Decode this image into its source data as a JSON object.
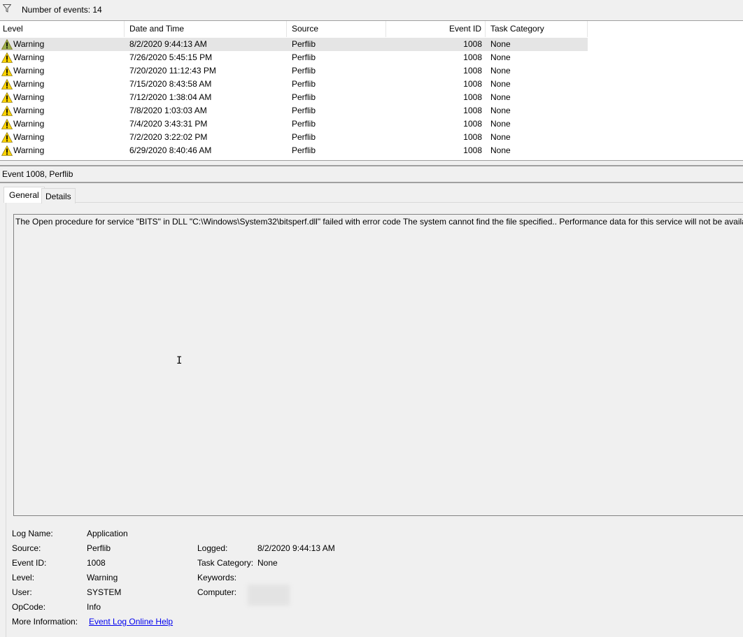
{
  "toolbar": {
    "event_count": "Number of events: 14"
  },
  "columns": [
    "Level",
    "Date and Time",
    "Source",
    "Event ID",
    "Task Category"
  ],
  "events": [
    {
      "level": "Warning",
      "date": "8/2/2020 9:44:13 AM",
      "source": "Perflib",
      "id": "1008",
      "task": "None"
    },
    {
      "level": "Warning",
      "date": "7/26/2020 5:45:15 PM",
      "source": "Perflib",
      "id": "1008",
      "task": "None"
    },
    {
      "level": "Warning",
      "date": "7/20/2020 11:12:43 PM",
      "source": "Perflib",
      "id": "1008",
      "task": "None"
    },
    {
      "level": "Warning",
      "date": "7/15/2020 8:43:58 AM",
      "source": "Perflib",
      "id": "1008",
      "task": "None"
    },
    {
      "level": "Warning",
      "date": "7/12/2020 1:38:04 AM",
      "source": "Perflib",
      "id": "1008",
      "task": "None"
    },
    {
      "level": "Warning",
      "date": "7/8/2020 1:03:03 AM",
      "source": "Perflib",
      "id": "1008",
      "task": "None"
    },
    {
      "level": "Warning",
      "date": "7/4/2020 3:43:31 PM",
      "source": "Perflib",
      "id": "1008",
      "task": "None"
    },
    {
      "level": "Warning",
      "date": "7/2/2020 3:22:02 PM",
      "source": "Perflib",
      "id": "1008",
      "task": "None"
    },
    {
      "level": "Warning",
      "date": "6/29/2020 8:40:46 AM",
      "source": "Perflib",
      "id": "1008",
      "task": "None"
    }
  ],
  "detail": {
    "title": "Event 1008, Perflib",
    "tabs": [
      "General",
      "Details"
    ],
    "message": "The Open procedure for service \"BITS\" in DLL \"C:\\Windows\\System32\\bitsperf.dll\" failed with error code The system cannot find the file specified.. Performance data for this service will not be available.",
    "labels": {
      "log_name": "Log Name:",
      "source": "Source:",
      "event_id": "Event ID:",
      "level": "Level:",
      "user": "User:",
      "opcode": "OpCode:",
      "more_info": "More Information:",
      "logged": "Logged:",
      "task_category": "Task Category:",
      "keywords": "Keywords:",
      "computer": "Computer:"
    },
    "values": {
      "log_name": "Application",
      "source": "Perflib",
      "event_id": "1008",
      "level": "Warning",
      "user": "SYSTEM",
      "opcode": "Info",
      "more_info": "Event Log Online Help",
      "logged": "8/2/2020 9:44:13 AM",
      "task_category": "None"
    }
  },
  "colors": {
    "warning": "#ffd400",
    "selected_warning": "#9bb04a",
    "link": "#0000ee"
  }
}
